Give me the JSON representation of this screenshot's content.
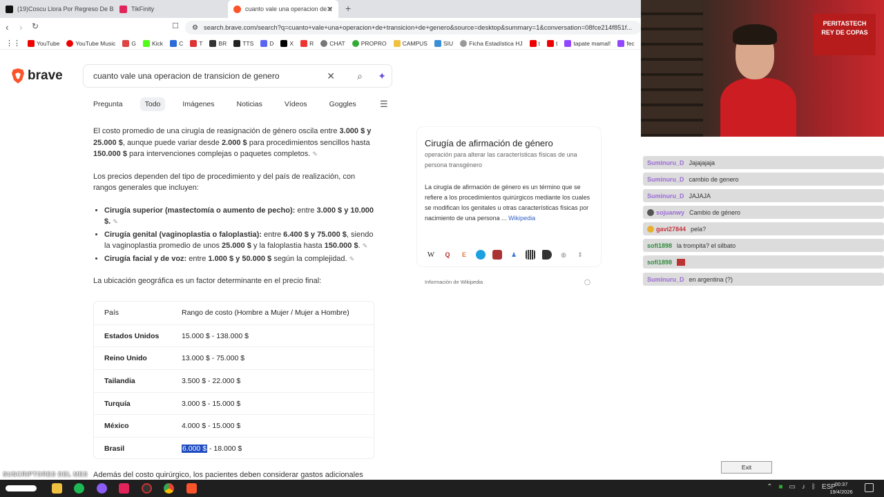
{
  "browser": {
    "tabs": [
      {
        "title": "(19)Coscu Llora Por Regreso De Bana",
        "active": false
      },
      {
        "title": "TikFinity",
        "active": false
      },
      {
        "title": "cuanto vale una operacion de tr",
        "active": true
      }
    ],
    "url": "search.brave.com/search?q=cuanto+vale+una+operacion+de+transicion+de+genero&source=desktop&summary=1&conversation=08fce214f851f...",
    "bookmarks": [
      "YouTube",
      "YouTube Music",
      "G",
      "Kick",
      "C",
      "T",
      "BR",
      "TTS",
      "D",
      "X",
      "R",
      "CHAT",
      "PROPRO",
      "CAMPUS",
      "SIU",
      "Ficha Estadística HJ",
      "t",
      "t",
      "tapate mamal!",
      "fec"
    ]
  },
  "brave": {
    "logo_text": "brave",
    "query": "cuanto vale una operacion de transicion de genero",
    "tabs": [
      "Pregunta",
      "Todo",
      "Imágenes",
      "Noticias",
      "Vídeos",
      "Goggles"
    ],
    "active_tab": "Todo"
  },
  "answer": {
    "p1_a": "El costo promedio de una cirugía de reasignación de género oscila entre ",
    "p1_b": "3.000 $ y 25.000 $",
    "p1_c": ", aunque puede variar desde ",
    "p1_d": "2.000 $",
    "p1_e": " para procedimientos sencillos hasta ",
    "p1_f": "150.000 $",
    "p1_g": " para intervenciones complejas o paquetes completos.",
    "p2": "Los precios dependen del tipo de procedimiento y del país de realización, con rangos generales que incluyen:",
    "b1_a": "Cirugía superior (mastectomía o aumento de pecho):",
    "b1_b": " entre ",
    "b1_c": "3.000 $ y 10.000 $.",
    "b2_a": "Cirugía genital (vaginoplastia o faloplastia):",
    "b2_b": " entre ",
    "b2_c": "6.400 $ y 75.000 $",
    "b2_d": ", siendo la vaginoplastia promedio de unos ",
    "b2_e": "25.000 $",
    "b2_f": " y la faloplastia hasta ",
    "b2_g": "150.000 $",
    "b2_h": ".",
    "b3_a": "Cirugía facial y de voz:",
    "b3_b": " entre ",
    "b3_c": "1.000 $ y 50.000 $",
    "b3_d": " según la complejidad.",
    "p3": "La ubicación geográfica es un factor determinante en el precio final:",
    "footer": "Además del costo quirúrgico, los pacientes deben considerar gastos adicionales"
  },
  "cost_table": {
    "headers": [
      "País",
      "Rango de costo (Hombre a Mujer / Mujer a Hombre)"
    ],
    "rows": [
      {
        "country": "Estados Unidos",
        "range": "15.000 $ - 138.000 $"
      },
      {
        "country": "Reino Unido",
        "range": "13.000 $ - 75.000 $"
      },
      {
        "country": "Tailandia",
        "range": "3.500 $ - 22.000 $"
      },
      {
        "country": "Turquía",
        "range": "3.000 $ - 15.000 $"
      },
      {
        "country": "México",
        "range": "4.000 $ - 15.000 $"
      },
      {
        "country": "Brasil",
        "range_selected": "6.000 $",
        "range_rest": " - 18.000 $"
      }
    ]
  },
  "infobox": {
    "title": "Cirugía de afirmación de género",
    "subtitle": "operación para alterar las características físicas de una persona transgénero",
    "body": "La cirugía de afirmación de género es un término que se refiere a los procedimientos quirúrgicos mediante los cuales se modifican los genitales u otras características físicas por nacimiento de una persona ...",
    "link": "Wikipedia",
    "source": "Información de Wikipedia"
  },
  "stream": {
    "banner": "REY DE COPAS",
    "banner_brand": "PERITASTECH",
    "overlay_subs": "SUSCRIPTORES DEL MES",
    "exit_label": "Exit"
  },
  "chat": [
    {
      "user": "Suminuru_D",
      "text": "Jajajajaja",
      "color": "#9b6bd6"
    },
    {
      "user": "Suminuru_D",
      "text": "cambio de genero",
      "color": "#9b6bd6"
    },
    {
      "user": "Suminuru_D",
      "text": "JAJAJA",
      "color": "#9b6bd6"
    },
    {
      "user": "sojuanwy",
      "text": "Cambio de género",
      "color": "#9b6bd6"
    },
    {
      "user": "gavi27844",
      "text": "pela?",
      "color": "#c8323c"
    },
    {
      "user": "sofi1898",
      "text": "la trompita? el silbato",
      "color": "#2f8a3a"
    },
    {
      "user": "sofi1898",
      "text": "",
      "color": "#2f8a3a"
    },
    {
      "user": "Suminuru_D",
      "text": "en argentina (?)",
      "color": "#9b6bd6"
    }
  ],
  "taskbar": {
    "language": "ESP",
    "time": "00:37",
    "date": "19/4/2026"
  }
}
